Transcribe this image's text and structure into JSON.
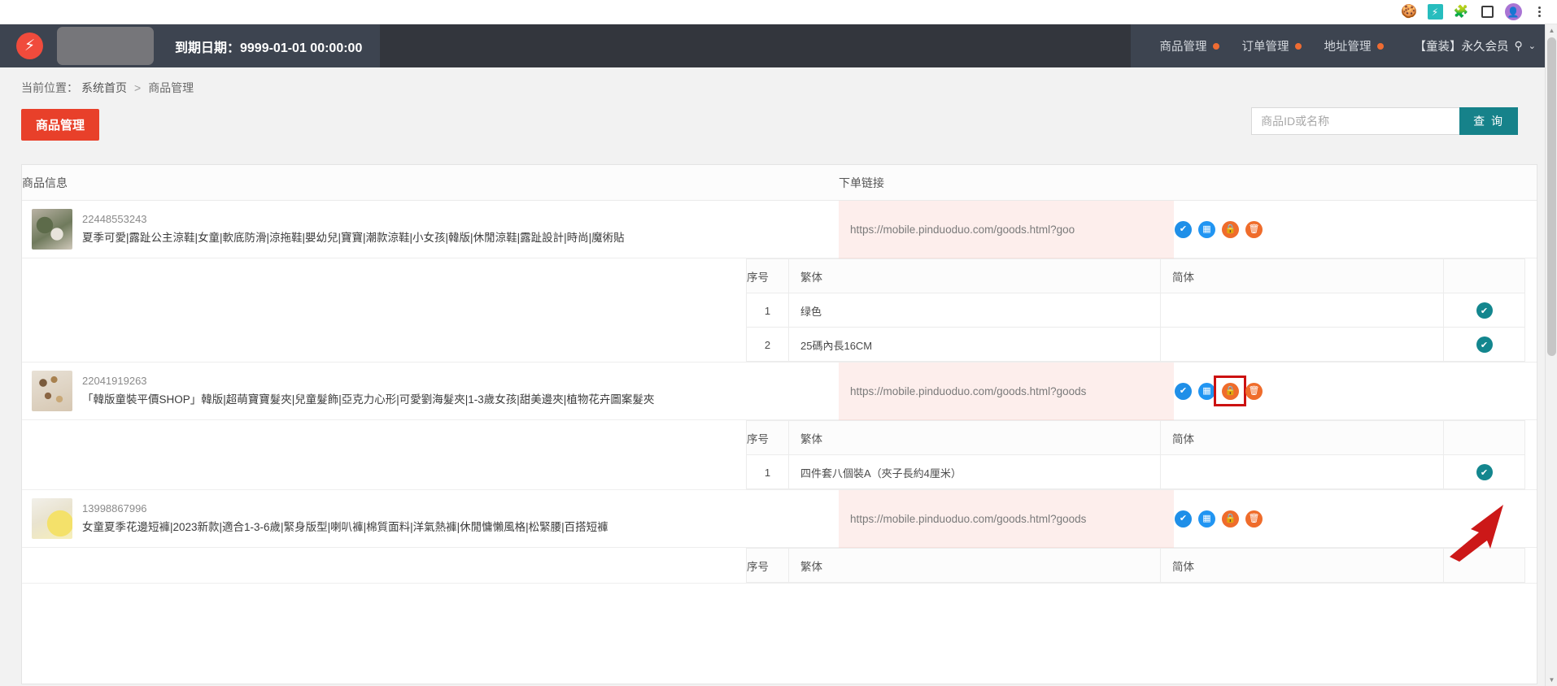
{
  "browser": {
    "toolbar_icons": [
      {
        "name": "cookie-icon",
        "glyph": "🍪"
      },
      {
        "name": "extension-teal-icon",
        "glyph": "⚡"
      },
      {
        "name": "extensions-puzzle-icon",
        "glyph": "🧩"
      },
      {
        "name": "sidepanel-icon",
        "glyph": ""
      },
      {
        "name": "profile-avatar-icon",
        "glyph": "👤"
      },
      {
        "name": "chrome-menu-icon",
        "glyph": ""
      }
    ]
  },
  "header": {
    "logo_glyph": "⚡",
    "expire_label": "到期日期：9999-01-01 00:00:00",
    "nav": [
      {
        "label": "商品管理",
        "dot": true
      },
      {
        "label": "订单管理",
        "dot": true
      },
      {
        "label": "地址管理",
        "dot": true
      }
    ],
    "user": {
      "label": "【童装】永久会员",
      "glyph": "⚲",
      "caret": "⌄"
    }
  },
  "breadcrumb": {
    "prefix": "当前位置：",
    "home": "系统首页",
    "separator": ">",
    "current": "商品管理"
  },
  "toolbar": {
    "section_button": "商品管理"
  },
  "search": {
    "placeholder": "商品ID或名称",
    "value": "",
    "button_label": "查 询"
  },
  "table": {
    "headers": {
      "info": "商品信息",
      "link": "下单链接",
      "ops": ""
    },
    "variant_headers": {
      "index": "序号",
      "traditional": "繁体",
      "simplified": "简体",
      "ops": ""
    },
    "op_buttons": [
      {
        "name": "approve-button",
        "glyph": "✔",
        "kind": "check"
      },
      {
        "name": "spec-table-button",
        "glyph": "▦",
        "kind": "grid"
      },
      {
        "name": "lock-button",
        "glyph": "🔒",
        "kind": "lock"
      },
      {
        "name": "delete-button",
        "glyph": "🗑",
        "kind": "trash"
      }
    ],
    "variant_op_glyph": "✔"
  },
  "products": [
    {
      "id": "22448553243",
      "title": "夏季可愛|露趾公主涼鞋|女童|軟底防滑|涼拖鞋|嬰幼兒|寶寶|潮款涼鞋|小女孩|韓版|休閒涼鞋|露趾設計|時尚|魔術貼",
      "link": "https://mobile.pinduoduo.com/goods.html?goo",
      "thumb": "green-sandals-photo",
      "variants": [
        {
          "index": "1",
          "traditional": "绿色",
          "simplified": ""
        },
        {
          "index": "2",
          "traditional": "25碼內長16CM",
          "simplified": ""
        }
      ]
    },
    {
      "id": "22041919263",
      "title": "「韓版童裝平價SHOP」韓版|超萌寶寶髮夾|兒童髮飾|亞克力心形|可愛劉海髮夾|1-3歲女孩|甜美邊夾|植物花卉圖案髮夾",
      "link": "https://mobile.pinduoduo.com/goods.html?goods",
      "thumb": "hair-clips-photo",
      "highlight_op": "lock-button",
      "variants": [
        {
          "index": "1",
          "traditional": "四件套八個裝A（夾子長約4厘米）",
          "simplified": ""
        }
      ]
    },
    {
      "id": "13998867996",
      "title": "女童夏季花邊短褲|2023新款|適合1-3-6歲|緊身版型|喇叭褲|棉質面料|洋氣熱褲|休閒慵懶風格|松緊腰|百搭短褲",
      "link": "https://mobile.pinduoduo.com/goods.html?goods",
      "thumb": "yellow-shorts-photo",
      "variants": []
    }
  ],
  "annotation": {
    "type": "red-arrow-pointing-to-lock-button",
    "color": "#cc1818"
  },
  "colors": {
    "brand_red": "#e8402a",
    "header_bg": "#33363d",
    "header_nav_bg": "#3d4450",
    "accent_teal": "#16828a",
    "badge_orange": "#ef6c32",
    "link_cell_bg": "#fdeeec",
    "annotation_red": "#cc1818"
  },
  "scrollbar": {
    "arrow_up": "▲",
    "arrow_down": "▼"
  }
}
